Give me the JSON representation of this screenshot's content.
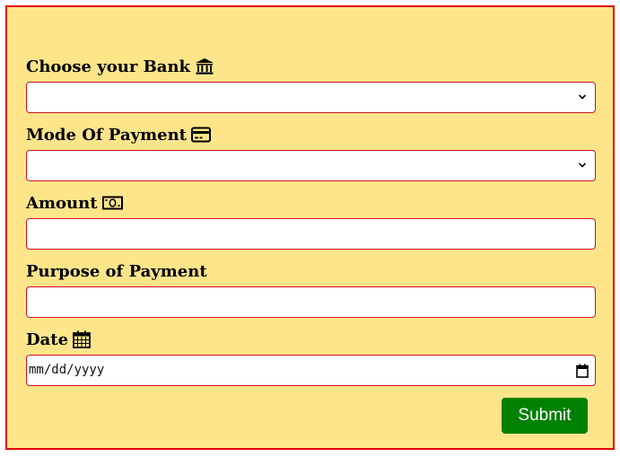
{
  "form": {
    "bank": {
      "label": "Choose your Bank",
      "icon": "bank-icon",
      "selected": ""
    },
    "payment_mode": {
      "label": "Mode Of Payment",
      "icon": "credit-card-icon",
      "selected": ""
    },
    "amount": {
      "label": "Amount",
      "icon": "money-bill-icon",
      "value": ""
    },
    "purpose": {
      "label": "Purpose of Payment",
      "value": ""
    },
    "date": {
      "label": "Date",
      "icon": "calendar-icon",
      "placeholder": "mm/dd/yyyy"
    },
    "submit_label": "Submit"
  },
  "colors": {
    "panel_background": "#ffe58a",
    "panel_border": "#e00000",
    "input_border": "#d01020",
    "submit_background": "#008000",
    "submit_text": "#ffffff"
  }
}
